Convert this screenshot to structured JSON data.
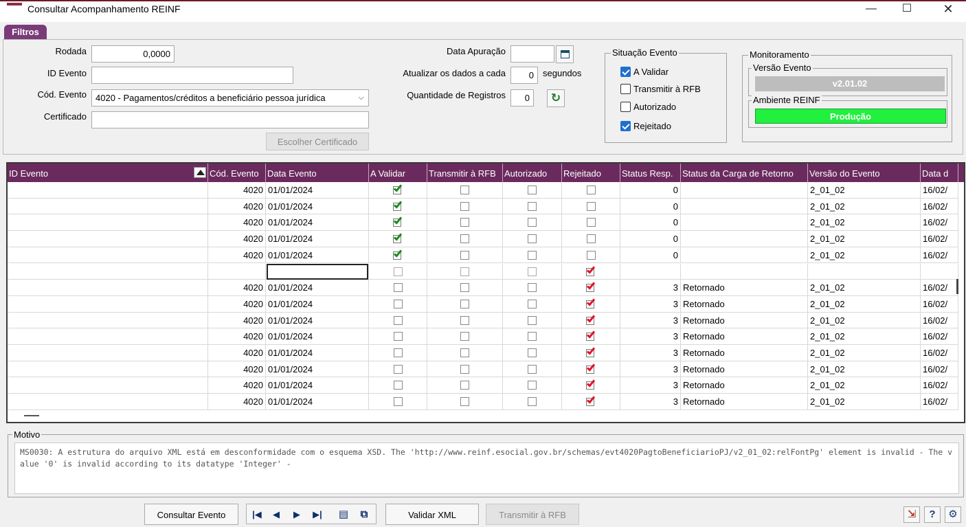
{
  "window": {
    "title": "Consultar Acompanhamento REINF",
    "minimize": "—",
    "maximize": "☐",
    "close": "✕"
  },
  "filters": {
    "tab_label": "Filtros",
    "rodada_label": "Rodada",
    "rodada_value": "0,0000",
    "id_evento_label": "ID Evento",
    "id_evento_value": "",
    "cod_evento_label": "Cód. Evento",
    "cod_evento_value": "4020 - Pagamentos/créditos a beneficiário pessoa jurídica",
    "certificado_label": "Certificado",
    "certificado_value": "",
    "escolher_certificado": "Escolher Certificado",
    "data_apuracao_label": "Data Apuração",
    "data_apuracao_value": "",
    "atualizar_label": "Atualizar os dados a cada",
    "atualizar_value": "0",
    "segundos_label": "segundos",
    "quantidade_label": "Quantidade de Registros",
    "quantidade_value": "0"
  },
  "situacao": {
    "title": "Situação Evento",
    "items": [
      {
        "label": "A Validar",
        "checked": true
      },
      {
        "label": "Transmitir à RFB",
        "checked": false
      },
      {
        "label": "Autorizado",
        "checked": false
      },
      {
        "label": "Rejeitado",
        "checked": true
      }
    ]
  },
  "monitoramento": {
    "title": "Monitoramento",
    "versao_label": "Versão Evento",
    "versao_value": "v2.01.02",
    "ambiente_label": "Ambiente REINF",
    "ambiente_value": "Produção",
    "ambiente_color": "#21f03e"
  },
  "grid": {
    "headers": [
      "ID Evento",
      "Cód. Evento",
      "Data Evento",
      "A Validar",
      "Transmitir à RFB",
      "Autorizado",
      "Rejeitado",
      "Status Resp.",
      "Status da Carga de Retorno",
      "Versão do Evento",
      "Data d"
    ],
    "rows": [
      {
        "id": "",
        "cod": "4020",
        "data": "01/01/2024",
        "validar": true,
        "transmitir": false,
        "autorizado": false,
        "rejeitado": false,
        "status": "0",
        "carga": "",
        "versao": "2_01_02",
        "data2": "16/02/"
      },
      {
        "id": "",
        "cod": "4020",
        "data": "01/01/2024",
        "validar": true,
        "transmitir": false,
        "autorizado": false,
        "rejeitado": false,
        "status": "0",
        "carga": "",
        "versao": "2_01_02",
        "data2": "16/02/"
      },
      {
        "id": "",
        "cod": "4020",
        "data": "01/01/2024",
        "validar": true,
        "transmitir": false,
        "autorizado": false,
        "rejeitado": false,
        "status": "0",
        "carga": "",
        "versao": "2_01_02",
        "data2": "16/02/"
      },
      {
        "id": "",
        "cod": "4020",
        "data": "01/01/2024",
        "validar": true,
        "transmitir": false,
        "autorizado": false,
        "rejeitado": false,
        "status": "0",
        "carga": "",
        "versao": "2_01_02",
        "data2": "16/02/"
      },
      {
        "id": "",
        "cod": "4020",
        "data": "01/01/2024",
        "validar": true,
        "transmitir": false,
        "autorizado": false,
        "rejeitado": false,
        "status": "0",
        "carga": "",
        "versao": "2_01_02",
        "data2": "16/02/"
      },
      {
        "id": "",
        "cod": "",
        "data": "",
        "validar": false,
        "transmitir": false,
        "autorizado": false,
        "rejeitado": true,
        "status": "",
        "carga": "",
        "versao": "",
        "data2": "",
        "editing": true
      },
      {
        "id": "",
        "cod": "4020",
        "data": "01/01/2024",
        "validar": false,
        "transmitir": false,
        "autorizado": false,
        "rejeitado": true,
        "status": "3",
        "carga": "Retornado",
        "versao": "2_01_02",
        "data2": "16/02/"
      },
      {
        "id": "",
        "cod": "4020",
        "data": "01/01/2024",
        "validar": false,
        "transmitir": false,
        "autorizado": false,
        "rejeitado": true,
        "status": "3",
        "carga": "Retornado",
        "versao": "2_01_02",
        "data2": "16/02/"
      },
      {
        "id": "",
        "cod": "4020",
        "data": "01/01/2024",
        "validar": false,
        "transmitir": false,
        "autorizado": false,
        "rejeitado": true,
        "status": "3",
        "carga": "Retornado",
        "versao": "2_01_02",
        "data2": "16/02/"
      },
      {
        "id": "",
        "cod": "4020",
        "data": "01/01/2024",
        "validar": false,
        "transmitir": false,
        "autorizado": false,
        "rejeitado": true,
        "status": "3",
        "carga": "Retornado",
        "versao": "2_01_02",
        "data2": "16/02/"
      },
      {
        "id": "",
        "cod": "4020",
        "data": "01/01/2024",
        "validar": false,
        "transmitir": false,
        "autorizado": false,
        "rejeitado": true,
        "status": "3",
        "carga": "Retornado",
        "versao": "2_01_02",
        "data2": "16/02/"
      },
      {
        "id": "",
        "cod": "4020",
        "data": "01/01/2024",
        "validar": false,
        "transmitir": false,
        "autorizado": false,
        "rejeitado": true,
        "status": "3",
        "carga": "Retornado",
        "versao": "2_01_02",
        "data2": "16/02/"
      },
      {
        "id": "",
        "cod": "4020",
        "data": "01/01/2024",
        "validar": false,
        "transmitir": false,
        "autorizado": false,
        "rejeitado": true,
        "status": "3",
        "carga": "Retornado",
        "versao": "2_01_02",
        "data2": "16/02/"
      },
      {
        "id": "",
        "cod": "4020",
        "data": "01/01/2024",
        "validar": false,
        "transmitir": false,
        "autorizado": false,
        "rejeitado": true,
        "status": "3",
        "carga": "Retornado",
        "versao": "2_01_02",
        "data2": "16/02/"
      }
    ]
  },
  "motivo": {
    "title": "Motivo",
    "text": "MS0030: A estrutura do arquivo XML está em desconformidade com o esquema XSD. The 'http://www.reinf.esocial.gov.br/schemas/evt4020PagtoBeneficiarioPJ/v2_01_02:relFontPg' element is invalid - The value '0' is invalid according to its datatype 'Integer' -"
  },
  "footer": {
    "consultar_evento": "Consultar Evento",
    "validar_xml": "Validar XML",
    "transmitir_rfb": "Transmitir à RFB",
    "nav_first": "|◀",
    "nav_prev": "◀",
    "nav_next": "▶",
    "nav_last": "▶|",
    "help": "?"
  }
}
